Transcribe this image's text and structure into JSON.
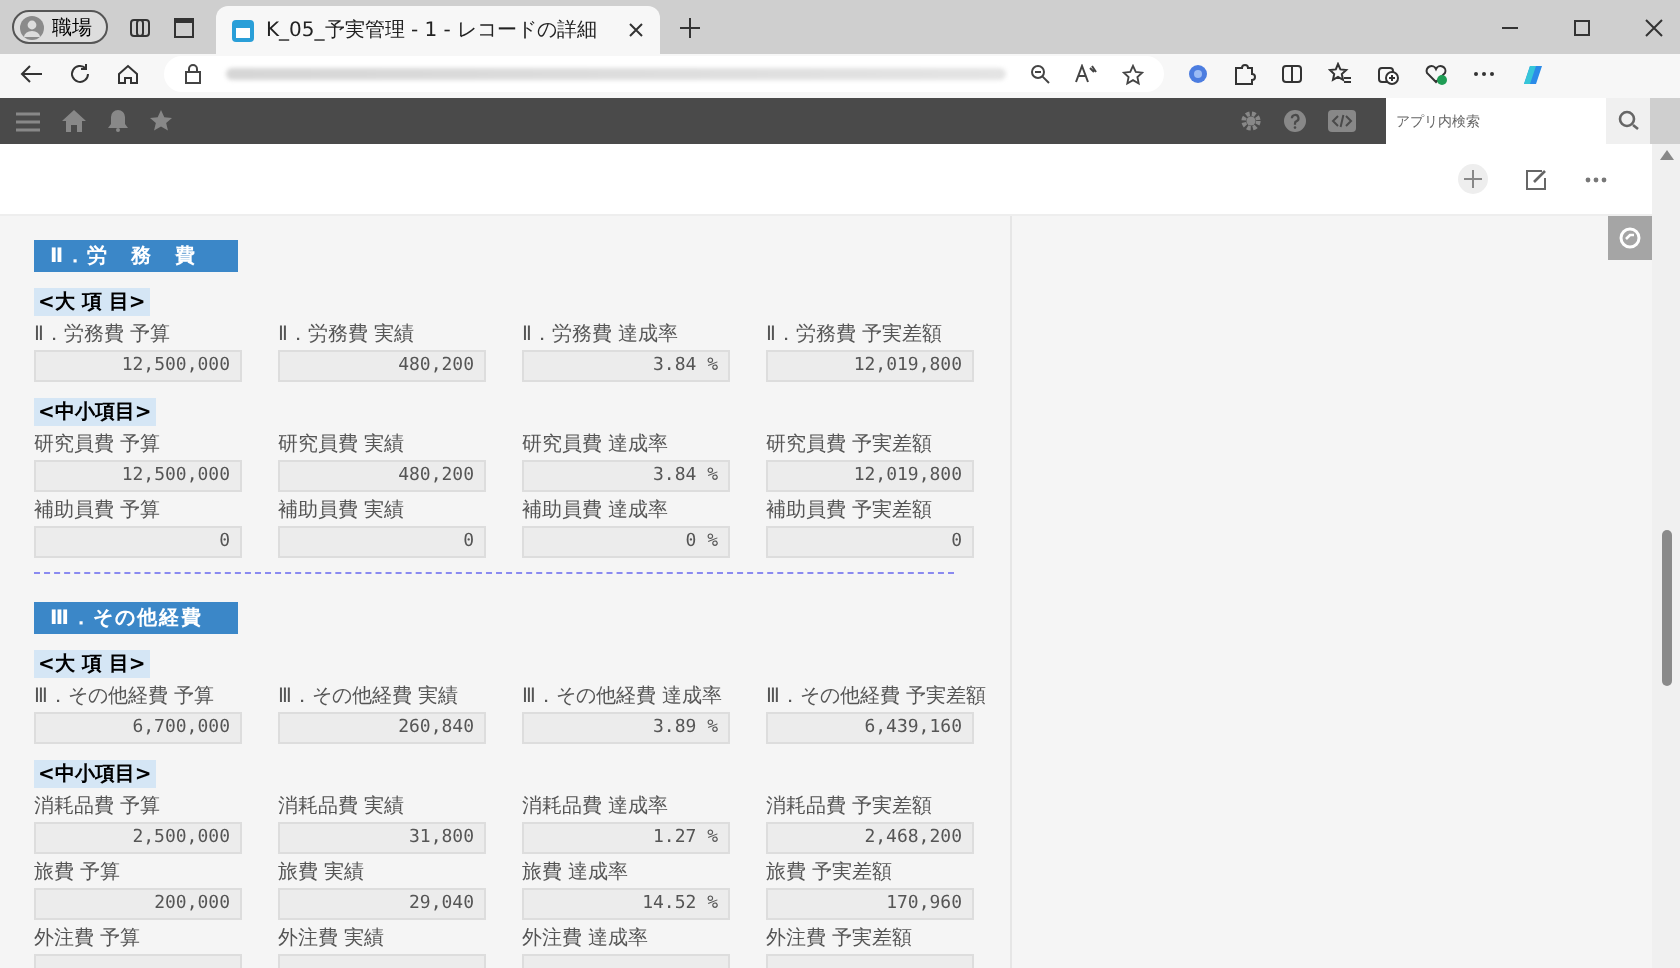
{
  "browser": {
    "profile": "職場",
    "tab_title": "K_05_予実管理 - 1 - レコードの詳細",
    "search_placeholder": "アプリ内検索"
  },
  "sections": [
    {
      "title": "Ⅱ．労　務　費",
      "groups": [
        {
          "label": "<大 項 目>",
          "rows": [
            [
              {
                "label": "Ⅱ．労務費 予算",
                "value": "12,500,000"
              },
              {
                "label": "Ⅱ．労務費 実績",
                "value": "480,200"
              },
              {
                "label": "Ⅱ．労務費 達成率",
                "value": "3.84 %"
              },
              {
                "label": "Ⅱ．労務費 予実差額",
                "value": "12,019,800"
              }
            ]
          ]
        },
        {
          "label": "<中小項目>",
          "rows": [
            [
              {
                "label": "研究員費 予算",
                "value": "12,500,000"
              },
              {
                "label": "研究員費 実績",
                "value": "480,200"
              },
              {
                "label": "研究員費 達成率",
                "value": "3.84 %"
              },
              {
                "label": "研究員費 予実差額",
                "value": "12,019,800"
              }
            ],
            [
              {
                "label": "補助員費 予算",
                "value": "0"
              },
              {
                "label": "補助員費 実績",
                "value": "0"
              },
              {
                "label": "補助員費 達成率",
                "value": "0 %"
              },
              {
                "label": "補助員費 予実差額",
                "value": "0"
              }
            ]
          ]
        }
      ]
    },
    {
      "title": "Ⅲ．その他経費",
      "groups": [
        {
          "label": "<大 項 目>",
          "rows": [
            [
              {
                "label": "Ⅲ．その他経費 予算",
                "value": "6,700,000"
              },
              {
                "label": "Ⅲ．その他経費 実績",
                "value": "260,840"
              },
              {
                "label": "Ⅲ．その他経費 達成率",
                "value": "3.89 %"
              },
              {
                "label": "Ⅲ．その他経費 予実差額",
                "value": "6,439,160"
              }
            ]
          ]
        },
        {
          "label": "<中小項目>",
          "rows": [
            [
              {
                "label": "消耗品費 予算",
                "value": "2,500,000"
              },
              {
                "label": "消耗品費 実績",
                "value": "31,800"
              },
              {
                "label": "消耗品費 達成率",
                "value": "1.27 %"
              },
              {
                "label": "消耗品費 予実差額",
                "value": "2,468,200"
              }
            ],
            [
              {
                "label": "旅費 予算",
                "value": "200,000"
              },
              {
                "label": "旅費 実績",
                "value": "29,040"
              },
              {
                "label": "旅費 達成率",
                "value": "14.52 %"
              },
              {
                "label": "旅費 予実差額",
                "value": "170,960"
              }
            ],
            [
              {
                "label": "外注費 予算"
              },
              {
                "label": "外注費 実績"
              },
              {
                "label": "外注費 達成率"
              },
              {
                "label": "外注費 予実差額"
              }
            ]
          ]
        }
      ]
    }
  ]
}
